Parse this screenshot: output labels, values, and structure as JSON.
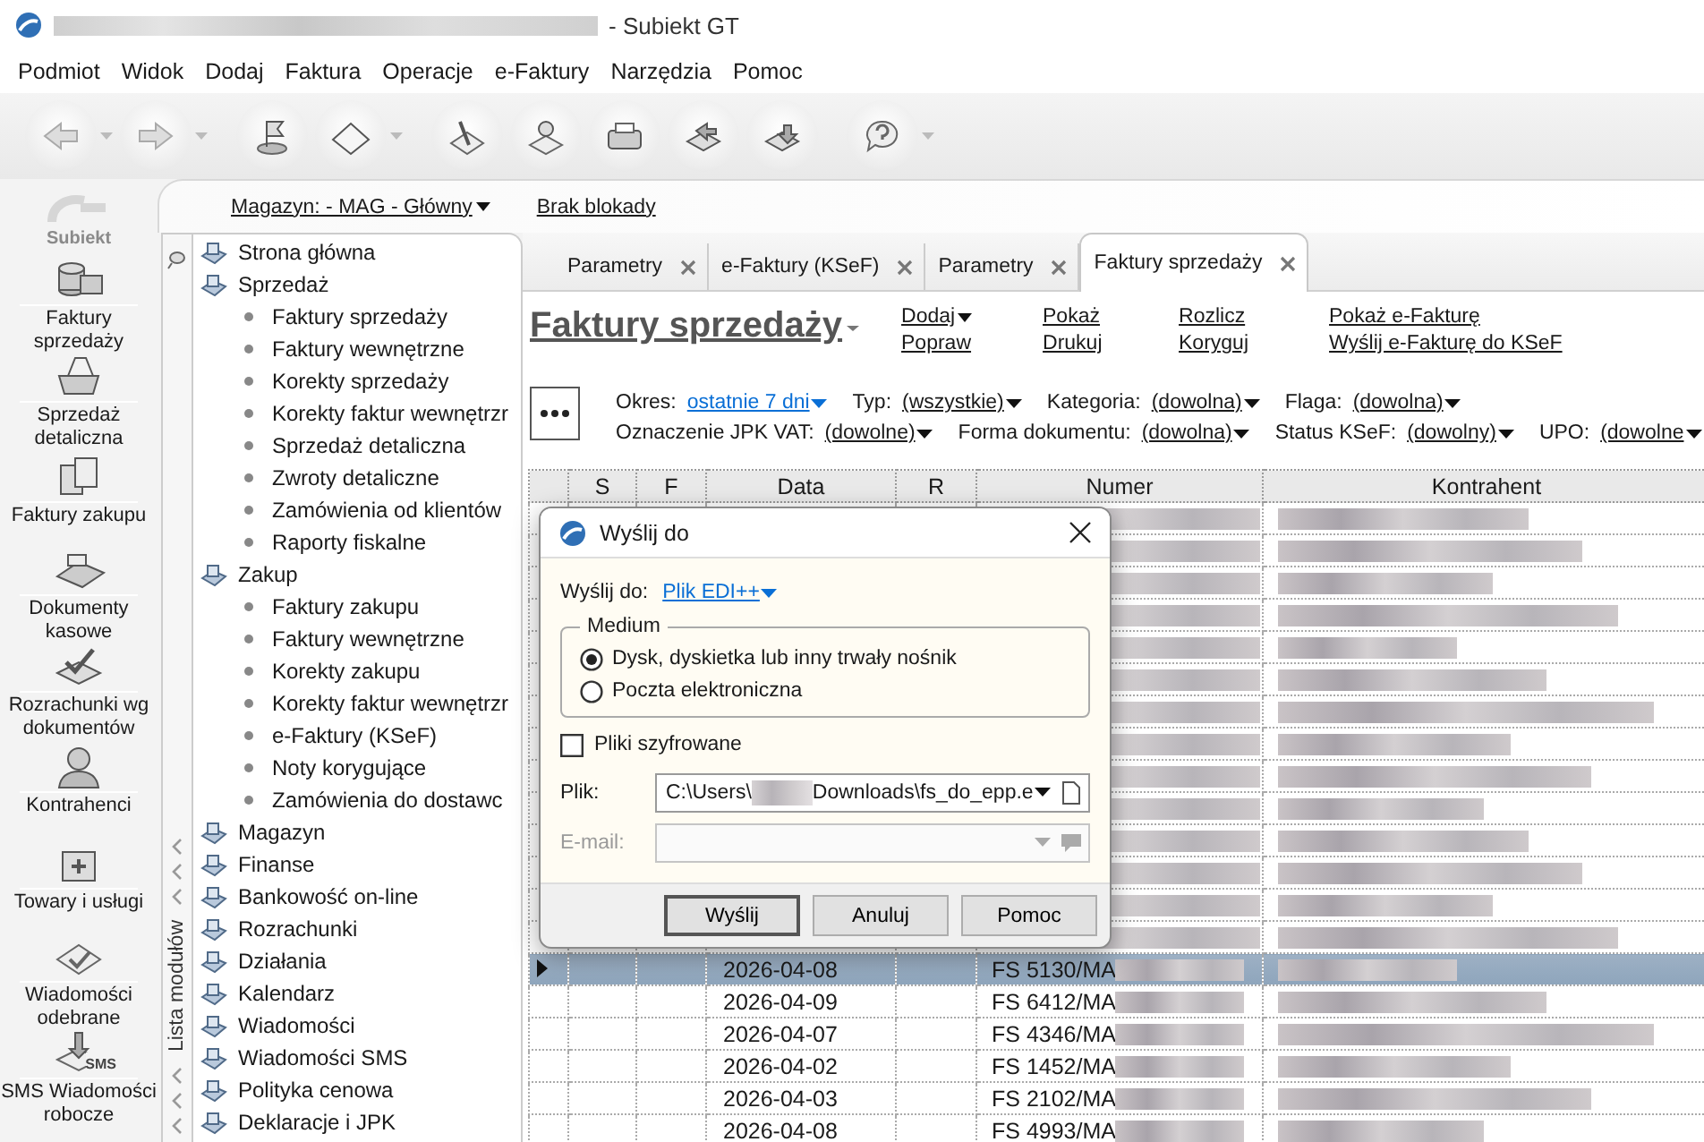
{
  "window": {
    "title": "- Subiekt GT"
  },
  "menu": [
    "Podmiot",
    "Widok",
    "Dodaj",
    "Faktura",
    "Operacje",
    "e-Faktury",
    "Narzędzia",
    "Pomoc"
  ],
  "warehouse": {
    "label": "Magazyn: - MAG - Główny",
    "lock": "Brak blokady"
  },
  "sidebar": {
    "logo": "Subiekt",
    "items": [
      {
        "label": "Faktury sprzedaży"
      },
      {
        "label": "Sprzedaż detaliczna"
      },
      {
        "label": "Faktury zakupu"
      },
      {
        "label": "Dokumenty kasowe"
      },
      {
        "label": "Rozrachunki wg dokumentów"
      },
      {
        "label": "Kontrahenci"
      },
      {
        "label": "Towary i usługi"
      },
      {
        "label": "Wiadomości odebrane"
      },
      {
        "label": "SMS Wiadomości robocze",
        "icon_text": "SMS"
      }
    ]
  },
  "tree": {
    "side_label": "Lista modułów",
    "items": [
      {
        "label": "Strona główna"
      },
      {
        "label": "Sprzedaż",
        "children": [
          {
            "label": "Faktury sprzedaży"
          },
          {
            "label": "Faktury wewnętrzne"
          },
          {
            "label": "Korekty sprzedaży"
          },
          {
            "label": "Korekty faktur wewnętrzr"
          },
          {
            "label": "Sprzedaż detaliczna"
          },
          {
            "label": "Zwroty detaliczne"
          },
          {
            "label": "Zamówienia od klientów"
          },
          {
            "label": "Raporty fiskalne"
          }
        ]
      },
      {
        "label": "Zakup",
        "children": [
          {
            "label": "Faktury zakupu"
          },
          {
            "label": "Faktury wewnętrzne"
          },
          {
            "label": "Korekty zakupu"
          },
          {
            "label": "Korekty faktur wewnętrzr"
          },
          {
            "label": "e-Faktury (KSeF)"
          },
          {
            "label": "Noty korygujące"
          },
          {
            "label": "Zamówienia do dostawc"
          }
        ]
      },
      {
        "label": "Magazyn"
      },
      {
        "label": "Finanse"
      },
      {
        "label": "Bankowość on-line"
      },
      {
        "label": "Rozrachunki"
      },
      {
        "label": "Działania"
      },
      {
        "label": "Kalendarz"
      },
      {
        "label": "Wiadomości"
      },
      {
        "label": "Wiadomości SMS"
      },
      {
        "label": "Polityka cenowa"
      },
      {
        "label": "Deklaracje i JPK"
      }
    ]
  },
  "tabs": [
    {
      "label": "Parametry",
      "selected": false
    },
    {
      "label": "e-Faktury (KSeF)",
      "selected": false
    },
    {
      "label": "Parametry",
      "selected": false
    },
    {
      "label": "Faktury sprzedaży",
      "selected": true
    }
  ],
  "header": {
    "title": "Faktury sprzedaży",
    "action_columns": [
      [
        {
          "label": "Dodaj",
          "dropdown": true
        },
        {
          "label": "Popraw",
          "dropdown": false
        }
      ],
      [
        {
          "label": "Pokaż",
          "dropdown": false
        },
        {
          "label": "Drukuj",
          "dropdown": false
        }
      ],
      [
        {
          "label": "Rozlicz",
          "dropdown": false
        },
        {
          "label": "Koryguj",
          "dropdown": false
        }
      ],
      [
        {
          "label": "Pokaż e-Fakturę",
          "dropdown": false
        },
        {
          "label": "Wyślij e-Fakturę do KSeF",
          "dropdown": false
        }
      ]
    ]
  },
  "filters": [
    [
      {
        "label": "Okres:",
        "value": "ostatnie 7 dni",
        "active": true
      },
      {
        "label": "Typ:",
        "value": "(wszystkie)",
        "active": false
      },
      {
        "label": "Kategoria:",
        "value": "(dowolna)",
        "active": false
      },
      {
        "label": "Flaga:",
        "value": "(dowolna)",
        "active": false
      }
    ],
    [
      {
        "label": "Oznaczenie JPK VAT:",
        "value": "(dowolne)",
        "active": false
      },
      {
        "label": "Forma dokumentu:",
        "value": "(dowolna)",
        "active": false
      },
      {
        "label": "Status KSeF:",
        "value": "(dowolny)",
        "active": false
      },
      {
        "label": "UPO:",
        "value": "(dowolne",
        "active": false
      }
    ]
  ],
  "table": {
    "columns": [
      "S",
      "F",
      "Data",
      "R",
      "Numer",
      "Kontrahent"
    ],
    "rows": [
      {
        "selected": false
      },
      {
        "selected": false
      },
      {
        "selected": false
      },
      {
        "selected": false
      },
      {
        "selected": false
      },
      {
        "selected": false
      },
      {
        "selected": false
      },
      {
        "selected": false
      },
      {
        "selected": false
      },
      {
        "selected": false
      },
      {
        "selected": false
      },
      {
        "selected": false
      },
      {
        "selected": false
      },
      {
        "selected": false
      },
      {
        "date": "2026-04-08",
        "number": "FS 5130/MA",
        "selected": true
      },
      {
        "date": "2026-04-09",
        "number": "FS 6412/MA",
        "selected": false
      },
      {
        "date": "2026-04-07",
        "number": "FS 4346/MA",
        "selected": false
      },
      {
        "date": "2026-04-02",
        "number": "FS 1452/MA",
        "selected": false
      },
      {
        "date": "2026-04-03",
        "number": "FS 2102/MA",
        "selected": false
      },
      {
        "date": "2026-04-08",
        "number": "FS 4993/MA",
        "selected": false
      }
    ]
  },
  "dialog": {
    "title": "Wyślij do",
    "send_to_label": "Wyślij do:",
    "send_to_value": "Plik EDI++",
    "group": "Medium",
    "options": [
      {
        "label": "Dysk, dyskietka lub inny trwały nośnik",
        "selected": true
      },
      {
        "label": "Poczta elektroniczna",
        "selected": false
      }
    ],
    "encrypted": {
      "label": "Pliki szyfrowane",
      "checked": false
    },
    "file": {
      "label": "Plik:",
      "value_start": "C:\\Users\\",
      "value_end": "Downloads\\fs_do_epp.e"
    },
    "email": {
      "label": "E-mail:",
      "disabled": true
    },
    "buttons": [
      "Wyślij",
      "Anuluj",
      "Pomoc"
    ]
  }
}
